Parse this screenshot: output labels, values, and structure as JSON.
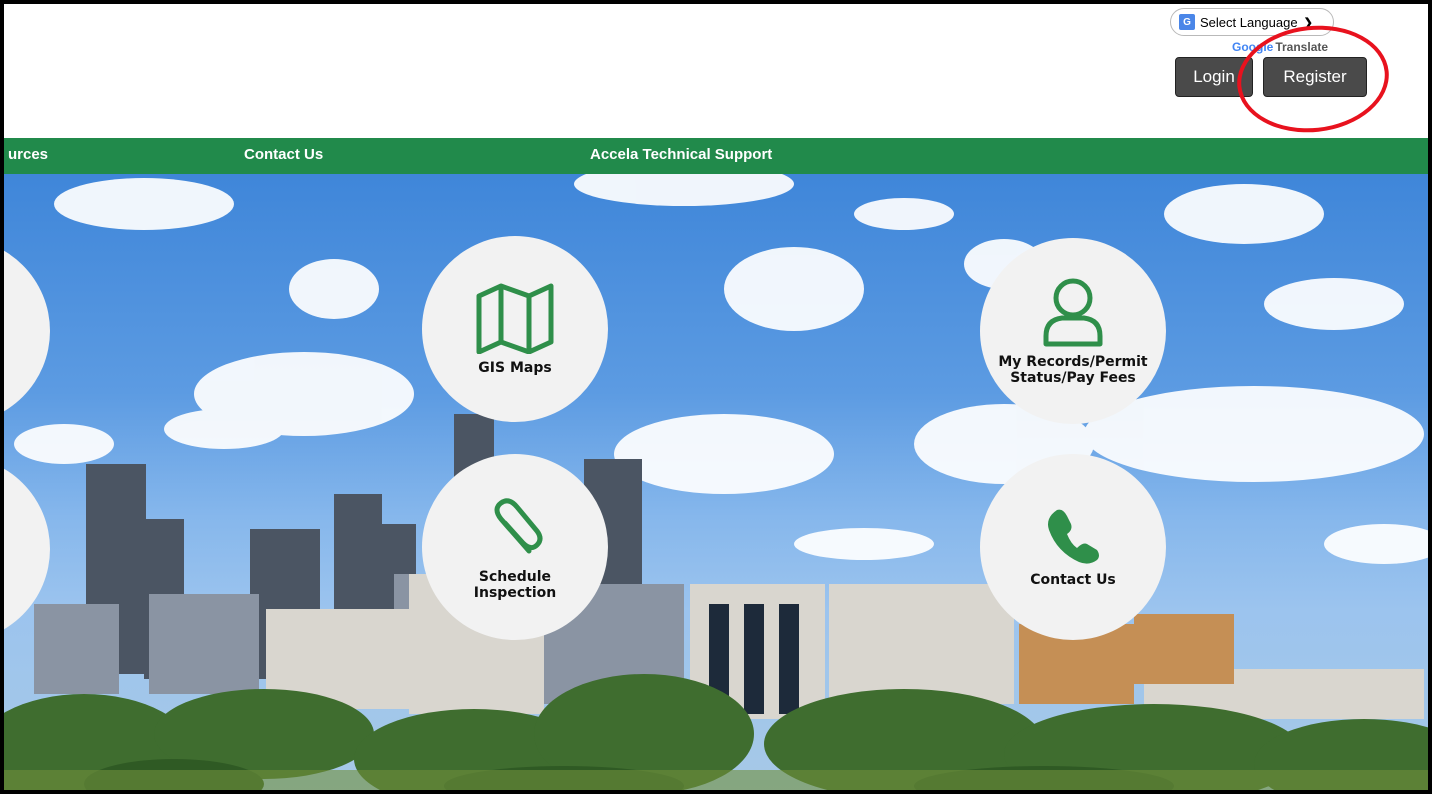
{
  "header": {
    "language_select": {
      "label": "Select Language",
      "icon": "google-translate-icon"
    },
    "powered_by": {
      "google": "Google",
      "translate": "Translate"
    },
    "buttons": {
      "login": "Login",
      "register": "Register"
    }
  },
  "nav": {
    "items": [
      {
        "label": "urces"
      },
      {
        "label": "Contact Us"
      },
      {
        "label": "Accela Technical Support"
      }
    ]
  },
  "tiles": [
    {
      "label": "GIS Maps",
      "icon": "map-icon"
    },
    {
      "label": "My Records/Permit Status/Pay Fees",
      "icon": "user-icon"
    },
    {
      "label": "Schedule Inspection",
      "icon": "paperclip-icon"
    },
    {
      "label": "Contact Us",
      "icon": "phone-icon"
    }
  ],
  "colors": {
    "nav_green": "#218a4b",
    "icon_green": "#2f8f4a",
    "button_dark": "#4a4a4a",
    "annotation_red": "#e8121e"
  }
}
